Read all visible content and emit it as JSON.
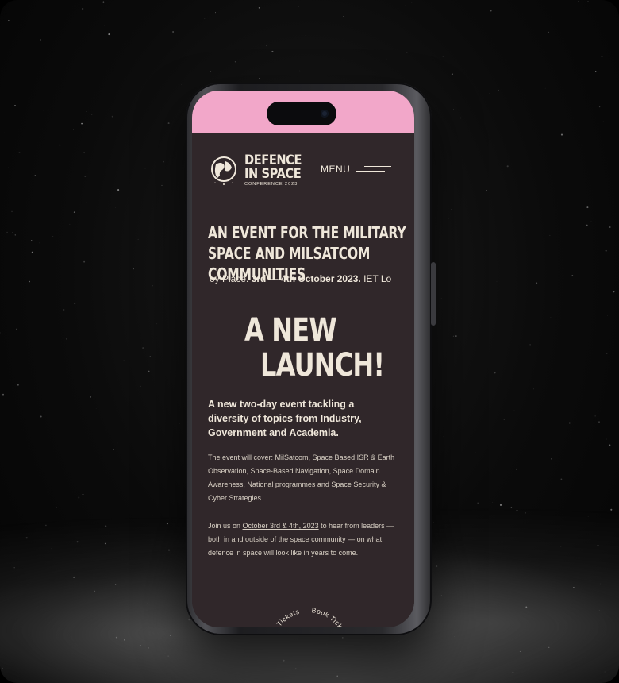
{
  "header": {
    "logo_line1": "DEFENCE",
    "logo_line2": "IN SPACE",
    "logo_line3": "CONFERENCE 2023",
    "menu_label": "MENU"
  },
  "hero": {
    "headline": "AN EVENT FOR THE MILITARY SPACE AND MILSATCOM COMMUNITIES",
    "ticker_before": "oy Place. ",
    "ticker_bold": "3rd — 4th October 2023.",
    "ticker_after": " IET Lo",
    "big_line1": "A NEW",
    "big_line2": "LAUNCH!"
  },
  "body": {
    "intro": "A new two-day event tackling a diversity of topics from Industry, Government and Academia.",
    "para1": "The event will cover: MilSatcom, Space Based ISR & Earth Observation, Space-Based Navigation, Space Domain Awareness, National programmes and Space Security & Cyber Strategies.",
    "para2_before": "Join us on ",
    "para2_link": "October 3rd & 4th, 2023",
    "para2_after": " to hear from leaders — both in and outside of the space community — on what defence in space will look like in years to come."
  },
  "cta": {
    "book_tickets": "Book Tickets"
  },
  "colors": {
    "screen_bg": "#30272a",
    "status_pink": "#f2a7c9",
    "text_cream": "#efe7da"
  }
}
